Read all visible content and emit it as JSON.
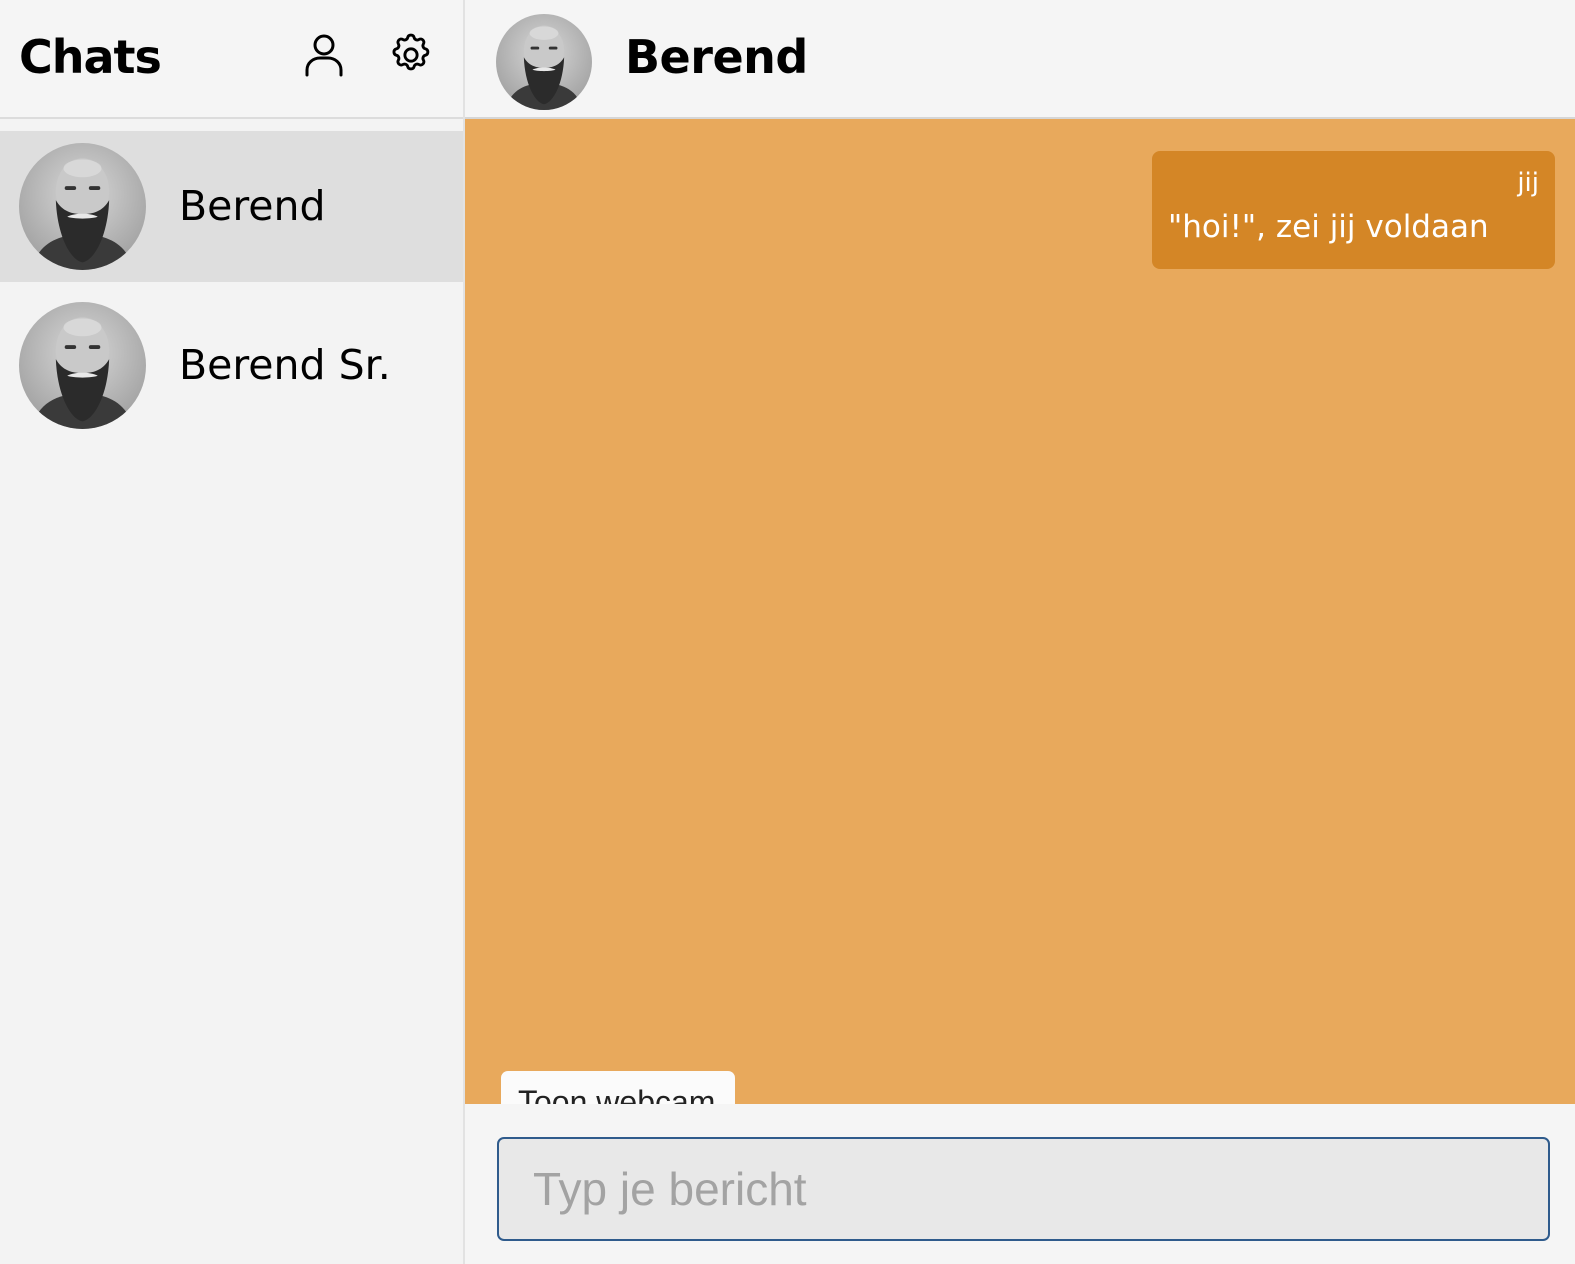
{
  "sidebar": {
    "title": "Chats",
    "icons": {
      "profile": "user-icon",
      "settings": "gear-icon"
    },
    "chats": [
      {
        "name": "Berend",
        "active": true
      },
      {
        "name": "Berend Sr.",
        "active": false
      }
    ]
  },
  "conversation": {
    "contact_name": "Berend",
    "messages": [
      {
        "sender": "jij",
        "text": "\"hoi!\", zei jij voldaan"
      }
    ]
  },
  "composer": {
    "webcam_toggle_label": "Toon webcam",
    "placeholder": "Typ je bericht",
    "value": ""
  },
  "colors": {
    "chat_background": "#e8a95c",
    "own_bubble": "#d48626",
    "active_chat": "#dedede",
    "input_border": "#2f5b8c"
  }
}
